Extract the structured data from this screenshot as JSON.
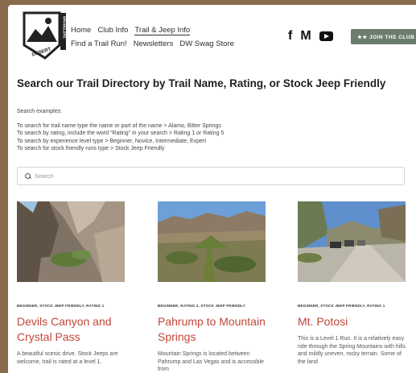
{
  "logo": {
    "text_top": "DESERT",
    "text_side": "WRANGLERS"
  },
  "nav": {
    "row1": [
      "Home",
      "Club Info",
      "Trail & Jeep Info"
    ],
    "row2": [
      "Find a Trail Run!",
      "Newsletters",
      "DW Swag Store"
    ],
    "active": "Trail & Jeep Info"
  },
  "social": {
    "facebook": "f",
    "meetup": "M"
  },
  "join_button": "★★ JOIN THE CLUB",
  "title": "Search our Trail Directory by Trail Name, Rating, or Stock Jeep Friendly",
  "examples_head": "Search examples:",
  "examples": [
    "To search for trail name type the name or part of the name > Alamo, Bitter Springs",
    "To search by rating, include the word \"Rating\" in your search > Rating 1 or Rating 5",
    "To search by experience level type > Beginner, Novice, Intermediate, Expert",
    "To search for stock friendly runs type > Stock Jeep Friendly"
  ],
  "search": {
    "placeholder": "Search"
  },
  "cards": [
    {
      "tags": "BEGINNER,   STOCK JEEP FRIENDLY,   RATING 1",
      "name": "Devils Canyon and Crystal Pass",
      "desc": "A beautiful scenic drive. Stock Jeeps are welcome, trail is rated at a level 1."
    },
    {
      "tags": "BEGINNER,   RATING 2,   STOCK JEEP FRIENDLY",
      "name": "Pahrump to Mountain Springs",
      "desc": "Mountain Springs is located between Pahrump and Las Vegas and is accessible from"
    },
    {
      "tags": "BEGINNER,   STOCK JEEP FRIENDLY,   RATING 1",
      "name": "Mt. Potosi",
      "desc": "This is a Level 1 Run. It is a relatively easy ride through the Spring Mountains with hills and mildly uneven, rocky terrain. Some of the land"
    }
  ]
}
